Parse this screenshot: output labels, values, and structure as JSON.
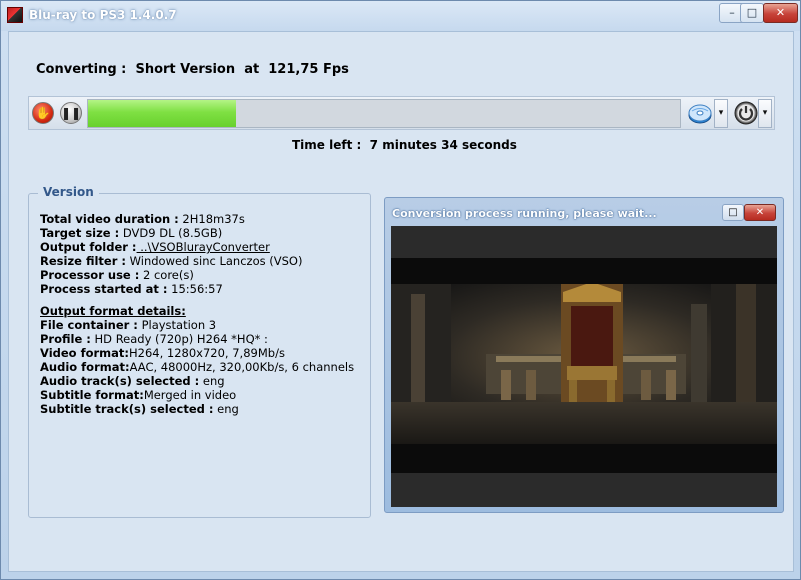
{
  "window": {
    "title": "Blu-ray to PS3 1.4.0.7",
    "minimize_icon": "minimize-icon",
    "maximize_icon": "maximize-icon",
    "close_icon": "close-icon"
  },
  "status": {
    "converting_label": "Converting :",
    "version_name": "Short Version",
    "at_label": "at",
    "fps": "121,75 Fps"
  },
  "progress": {
    "fraction": 0.25,
    "fill_color": "#7fe043"
  },
  "toolbar": {
    "stop_icon": "stop-hand-icon",
    "pause_icon": "pause-icon",
    "disc_icon": "disc-burn-icon",
    "power_icon": "power-icon",
    "dropdown_glyph": "▾"
  },
  "time_left": {
    "label": "Time left :",
    "value": "7 minutes 34 seconds"
  },
  "version_panel": {
    "title": "Version",
    "rows": [
      {
        "label": "Total video duration :",
        "value": " 2H18m37s"
      },
      {
        "label": "Target size :",
        "value": " DVD9 DL (8.5GB)"
      },
      {
        "label": "Output folder :",
        "value": " ..\\VSOBlurayConverter"
      },
      {
        "label": "Resize filter :",
        "value": " Windowed sinc Lanczos (VSO)"
      },
      {
        "label": "Processor use :",
        "value": " 2 core(s)"
      },
      {
        "label": "Process started at :",
        "value": " 15:56:57"
      }
    ],
    "output_header": "Output format details:",
    "output_rows": [
      {
        "label": "File container :",
        "value": " Playstation 3"
      },
      {
        "label": "Profile :",
        "value": " HD Ready (720p) H264 *HQ* :"
      },
      {
        "label": "Video format:",
        "value": "H264, 1280x720, 7,89Mb/s"
      },
      {
        "label": "Audio format:",
        "value": "AAC, 48000Hz, 320,00Kb/s, 6 channels"
      },
      {
        "label": "Audio track(s) selected :",
        "value": "  eng"
      },
      {
        "label": "Subtitle format:",
        "value": "Merged in video"
      },
      {
        "label": "Subtitle track(s) selected :",
        "value": "  eng"
      }
    ]
  },
  "preview": {
    "title": "Conversion process running, please wait...",
    "frame_description_icon": "video-frame-throne-scene"
  }
}
